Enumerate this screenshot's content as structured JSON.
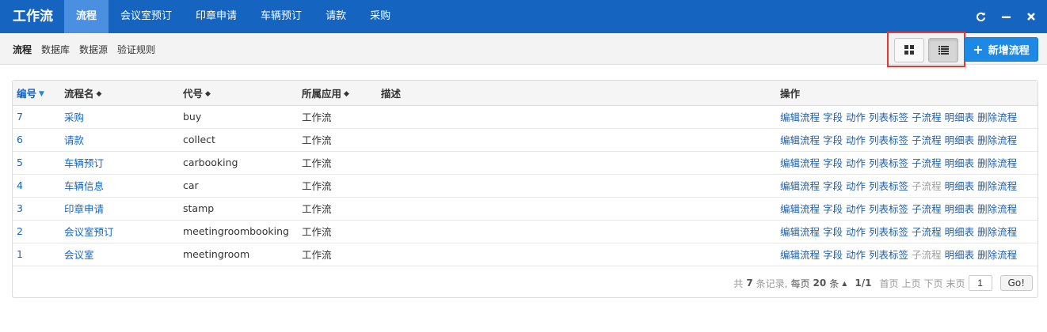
{
  "topnav": {
    "brand": "工作流",
    "tabs": [
      {
        "label": "流程",
        "active": true
      },
      {
        "label": "会议室预订"
      },
      {
        "label": "印章申请"
      },
      {
        "label": "车辆预订"
      },
      {
        "label": "请款"
      },
      {
        "label": "采购"
      }
    ],
    "controls": [
      "refresh-icon",
      "minimize-icon",
      "close-icon"
    ]
  },
  "subnav": {
    "items": [
      {
        "label": "流程",
        "active": true
      },
      {
        "label": "数据库"
      },
      {
        "label": "数据源"
      },
      {
        "label": "验证规则"
      }
    ]
  },
  "toolbar": {
    "view_icons": [
      "grid-view-icon",
      "list-view-icon"
    ],
    "active_view": "list",
    "add_label": "新增流程"
  },
  "table": {
    "headers": {
      "id": "编号",
      "name": "流程名",
      "code": "代号",
      "app": "所属应用",
      "desc": "描述",
      "ops": "操作"
    },
    "ops_labels": [
      "编辑流程",
      "字段",
      "动作",
      "列表标签",
      "子流程",
      "明细表",
      "删除流程"
    ],
    "rows": [
      {
        "id": "7",
        "name": "采购",
        "code": "buy",
        "app": "工作流",
        "desc": "",
        "subflow_disabled": false
      },
      {
        "id": "6",
        "name": "请款",
        "code": "collect",
        "app": "工作流",
        "desc": "",
        "subflow_disabled": false
      },
      {
        "id": "5",
        "name": "车辆预订",
        "code": "carbooking",
        "app": "工作流",
        "desc": "",
        "subflow_disabled": false
      },
      {
        "id": "4",
        "name": "车辆信息",
        "code": "car",
        "app": "工作流",
        "desc": "",
        "subflow_disabled": true
      },
      {
        "id": "3",
        "name": "印章申请",
        "code": "stamp",
        "app": "工作流",
        "desc": "",
        "subflow_disabled": false
      },
      {
        "id": "2",
        "name": "会议室预订",
        "code": "meetingroombooking",
        "app": "工作流",
        "desc": "",
        "subflow_disabled": false
      },
      {
        "id": "1",
        "name": "会议室",
        "code": "meetingroom",
        "app": "工作流",
        "desc": "",
        "subflow_disabled": true
      }
    ]
  },
  "pager": {
    "total_prefix": "共",
    "total": "7",
    "total_suffix": "条记录,",
    "per_page_prefix": "每页",
    "per_page": "20",
    "per_page_suffix": "条",
    "page_info": "1/1",
    "first": "首页",
    "prev": "上页",
    "next": "下页",
    "last": "末页",
    "current_page": "1",
    "go_label": "Go!"
  },
  "colors": {
    "nav_bg": "#1565c0",
    "nav_active": "#4a8fe0",
    "accent": "#1e88e5",
    "highlight_border": "#e53935"
  }
}
